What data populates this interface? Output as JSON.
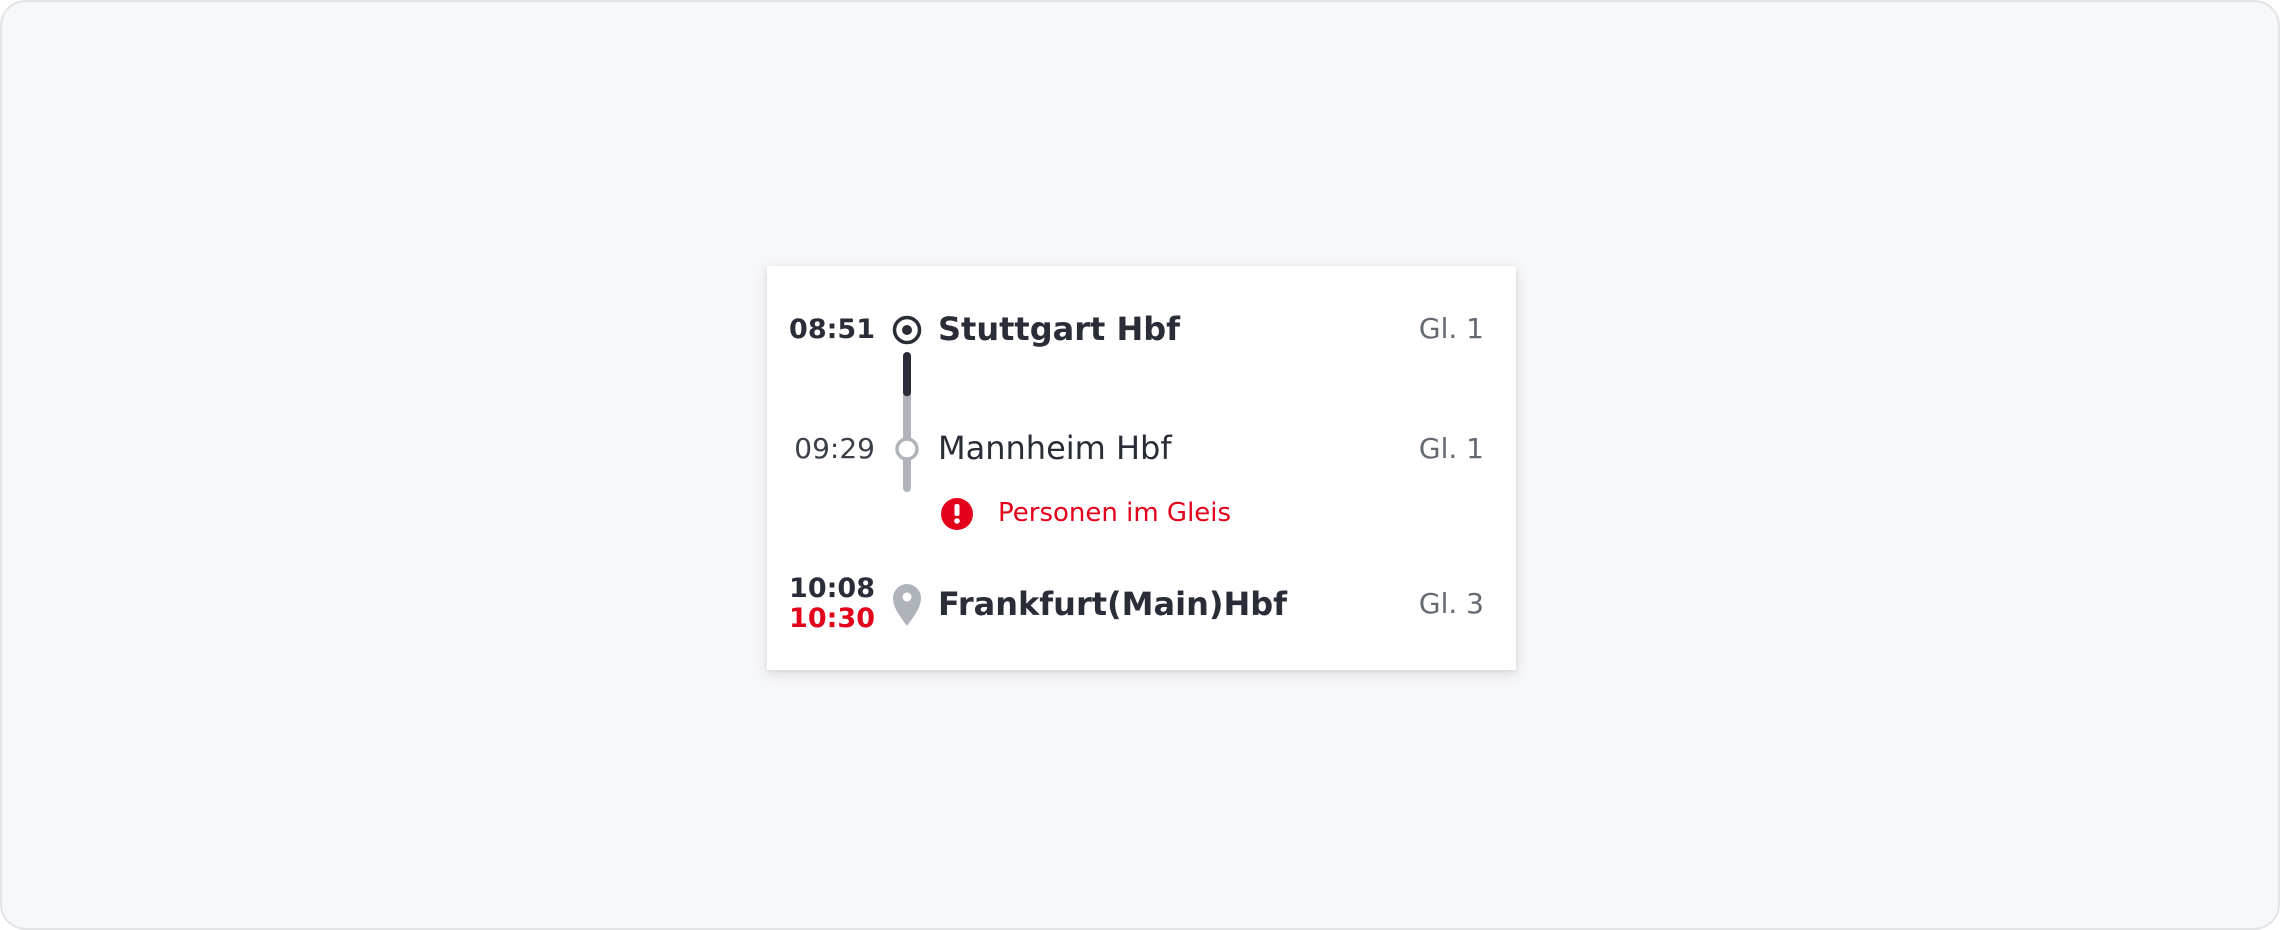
{
  "journey": {
    "stops": [
      {
        "time": "08:51",
        "station": "Stuttgart Hbf",
        "platform": "Gl. 1",
        "icon": "origin-circle-icon"
      },
      {
        "time": "09:29",
        "station": "Mannheim Hbf",
        "platform": "Gl. 1",
        "icon": "intermediate-stop-icon"
      },
      {
        "time": "10:08",
        "delayed_time": "10:30",
        "station": "Frankfurt(Main)Hbf",
        "platform": "Gl. 3",
        "icon": "destination-pin-icon"
      }
    ],
    "notice": {
      "text": "Personen im Gleis",
      "icon": "alert-icon"
    },
    "progress_fraction_first_segment": 0.25
  },
  "colors": {
    "text_dark": "#282d37",
    "text_muted": "#646973",
    "alert_red": "#e3001b",
    "line_done": "#282d37",
    "line_pending": "#afb4bb"
  }
}
